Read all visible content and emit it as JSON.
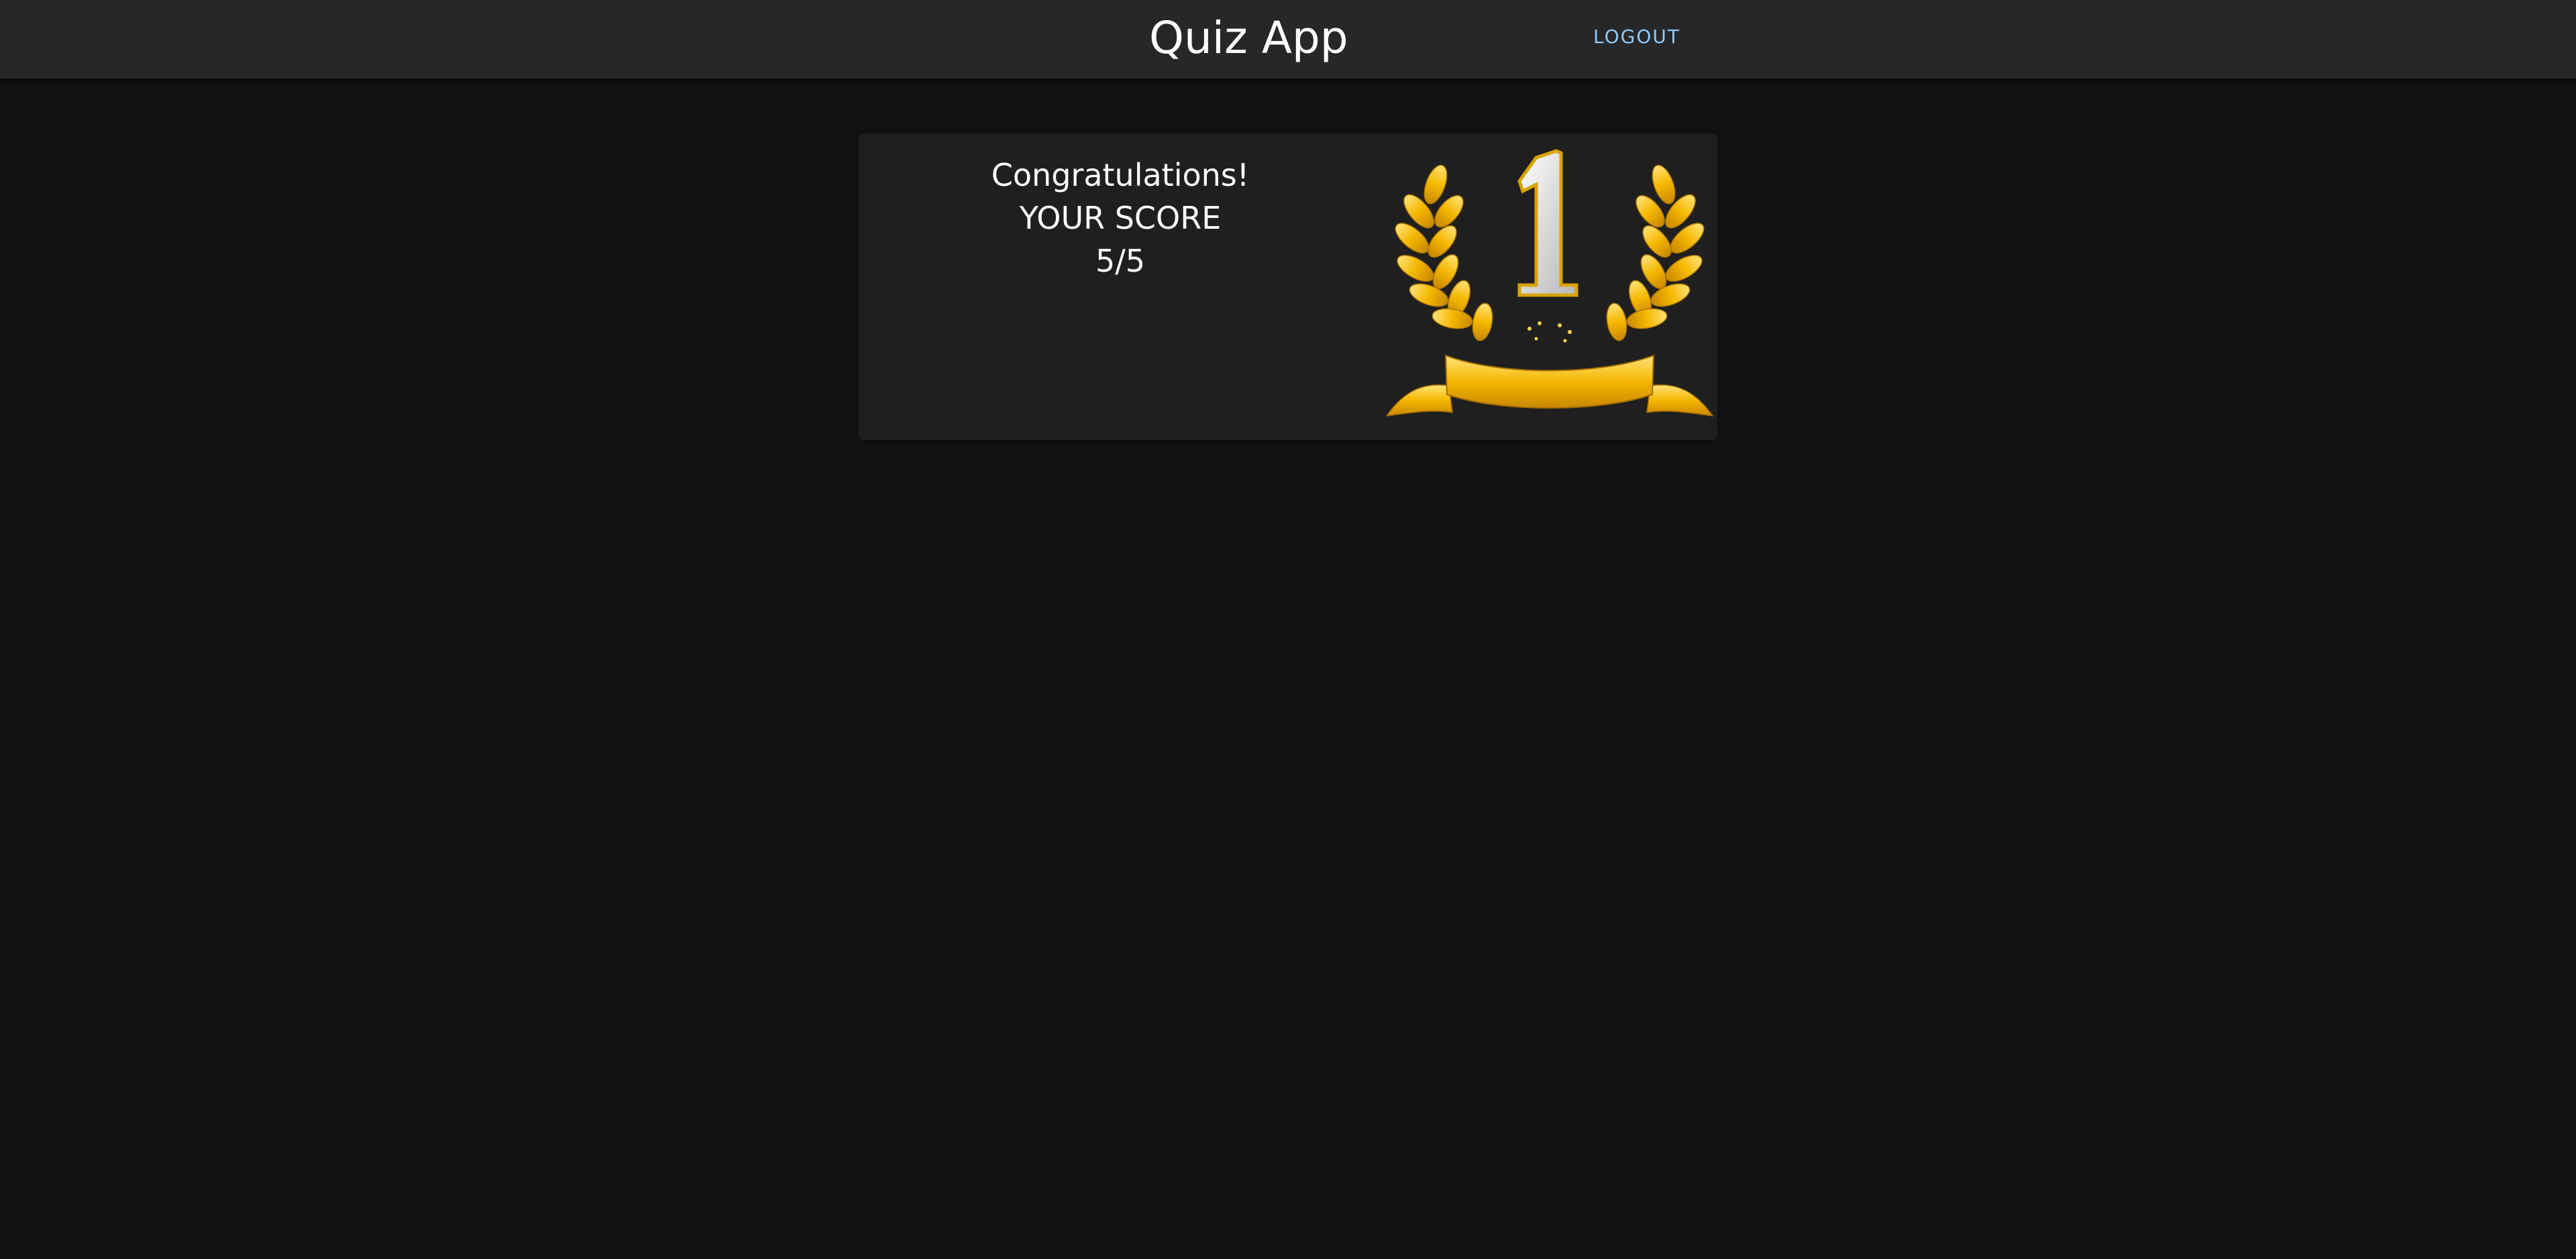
{
  "header": {
    "title": "Quiz App",
    "logout_label": "LOGOUT"
  },
  "result": {
    "congrats": "Congratulations!",
    "score_label": "YOUR SCORE",
    "score": "5/5",
    "image": "first-place-laurel-wreath-icon",
    "image_rank": "1"
  },
  "colors": {
    "background": "#121212",
    "appbar": "#272727",
    "card": "#1f1f1f",
    "link": "#90caf9",
    "gold": "#f5b800"
  }
}
